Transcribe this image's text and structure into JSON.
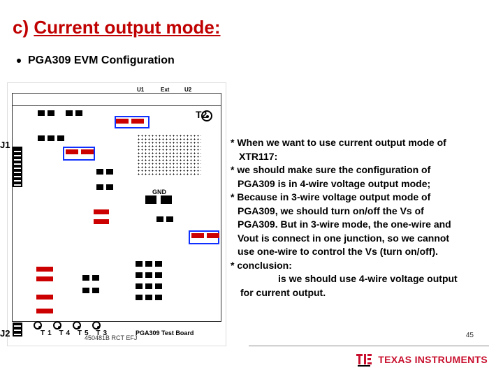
{
  "title_prefix": "c) ",
  "title_main": "Current output mode:",
  "subtitle": "PGA309 EVM Configuration",
  "pcb": {
    "t2": "T2",
    "j1": "J1",
    "j2": "J2",
    "gnd": "GND",
    "ic_pins_top": {
      "u1": "U1",
      "ext": "Ext",
      "u2": "U2"
    },
    "test_board": "PGA309 Test Board",
    "bottom_labels": "T1  T4  T5  T3",
    "footer": "450481B RCT EFJ"
  },
  "notes": {
    "l1": "* When we want to use current output mode of",
    "l2": "XTR117:",
    "l3": "* we should make sure the configuration of",
    "l4": "PGA309 is in 4-wire voltage output mode;",
    "l5": "* Because in 3-wire voltage output mode of",
    "l6": "PGA309, we should turn on/off the Vs of",
    "l7": "PGA309. But in 3-wire mode, the one-wire and",
    "l8": "Vout is connect in one junction, so we cannot",
    "l9": "use one-wire to control the Vs (turn on/off).",
    "l10": "* conclusion:",
    "l11": "is we should use 4-wire voltage output",
    "l12": "for current output."
  },
  "page_number": "45",
  "brand": "TEXAS INSTRUMENTS"
}
